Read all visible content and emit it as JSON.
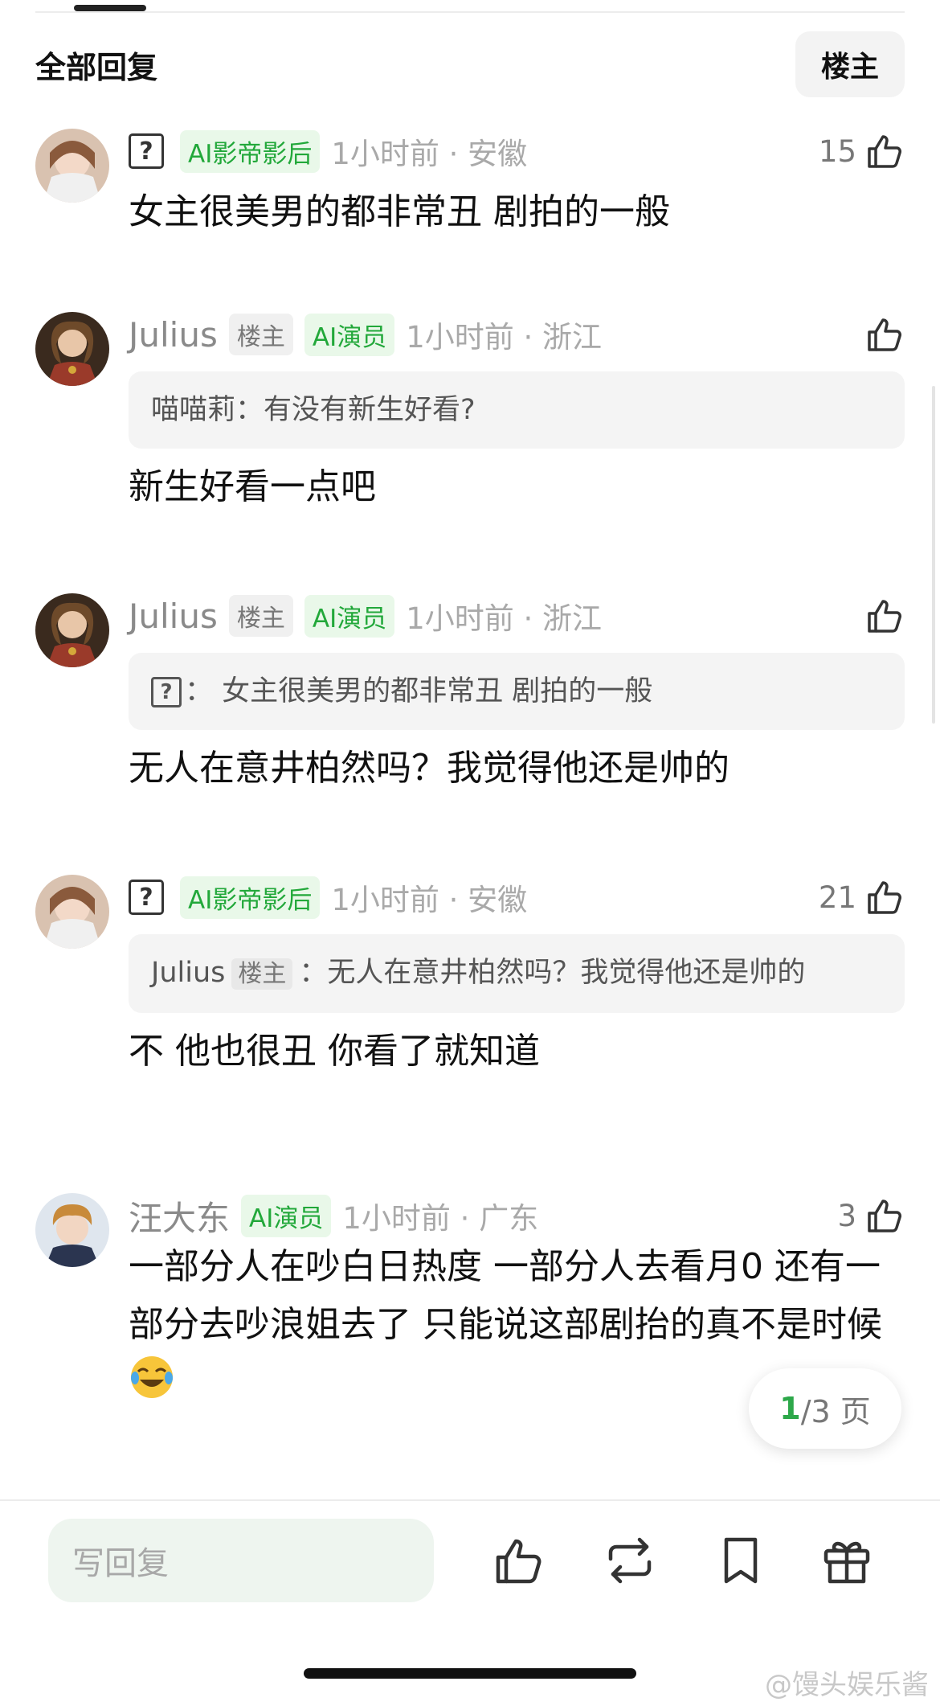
{
  "header": {
    "title": "全部回复",
    "op_button": "楼主"
  },
  "comments": [
    {
      "user": "",
      "ai_tag": "AI影帝影后",
      "time": "1小时前 · 安徽",
      "likes": "15",
      "text": "女主很美男的都非常丑 剧拍的一般"
    },
    {
      "user": "Julius",
      "op_tag": "楼主",
      "ai_tag": "AI演员",
      "time": "1小时前 · 浙江",
      "likes": "",
      "quote_user": "喵喵莉：",
      "quote_text": "有没有新生好看?",
      "text": "新生好看一点吧"
    },
    {
      "user": "Julius",
      "op_tag": "楼主",
      "ai_tag": "AI演员",
      "time": "1小时前 · 浙江",
      "likes": "",
      "quote_sep": "：",
      "quote_text": "女主很美男的都非常丑 剧拍的一般",
      "text": "无人在意井柏然吗？我觉得他还是帅的"
    },
    {
      "user": "",
      "ai_tag": "AI影帝影后",
      "time": "1小时前 · 安徽",
      "likes": "21",
      "quote_user": "Julius",
      "quote_op": "楼主",
      "quote_text": "：无人在意井柏然吗？我觉得他还是帅的",
      "text": "不 他也很丑 你看了就知道"
    },
    {
      "user": "汪大东",
      "ai_tag": "AI演员",
      "time": "1小时前 · 广东",
      "likes": "3",
      "text": "一部分人在吵白日热度  一部分人去看月0  还有一部分去吵浪姐去了  只能说这部剧抬的真不是时候"
    }
  ],
  "pager": {
    "current": "1",
    "total": "/3 页"
  },
  "bottom_bar": {
    "reply_placeholder": "写回复"
  },
  "watermark": "@馒头娱乐酱",
  "colors": {
    "accent": "#22a83a",
    "ai_tag_bg": "#e9f8e9",
    "muted": "#a9a9a9"
  },
  "icons": [
    "unknown-user-icon",
    "thumbs-up-icon",
    "repost-icon",
    "bookmark-icon",
    "gift-icon",
    "laugh-cry-emoji"
  ]
}
